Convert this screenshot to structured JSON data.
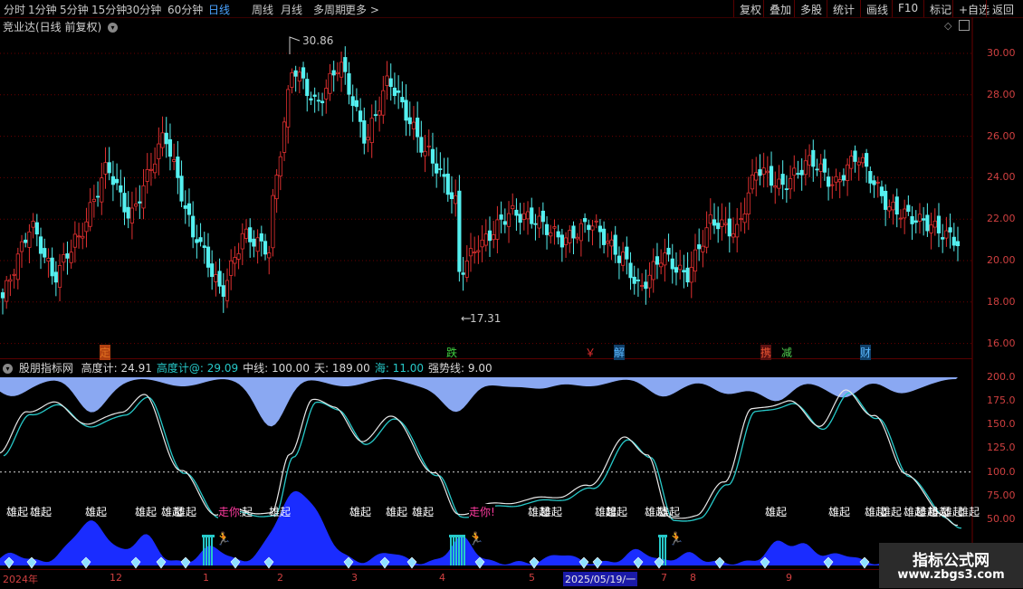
{
  "toolbar": {
    "periods": [
      "分时",
      "1分钟",
      "5分钟",
      "15分钟",
      "30分钟",
      "60分钟",
      "日线",
      "周线",
      "月线",
      "多周期",
      "更多 >"
    ],
    "active_period": "日线",
    "right_buttons": [
      "复权",
      "叠加",
      "多股",
      "统计",
      "画线",
      "F10",
      "标记",
      "+自选",
      "返回"
    ]
  },
  "main_chart": {
    "title": "竞业达(日线 前复权)",
    "price_ticks": [
      "30.00",
      "28.00",
      "26.00",
      "24.00",
      "22.00",
      "20.00",
      "18.00",
      "16.00"
    ],
    "max_label": "30.86",
    "min_label": "17.31",
    "signals": [
      "定",
      "跌",
      "￥",
      "解",
      "携",
      "减",
      "财"
    ]
  },
  "indicator": {
    "name": "股朋指标网",
    "items": [
      {
        "label": "高度计: 24.91",
        "color": "#d8d8d8"
      },
      {
        "label": "高度计@: 29.09",
        "color": "#27c9c9"
      },
      {
        "label": "中线: 100.00",
        "color": "#d8d8d8"
      },
      {
        "label": "天: 189.00",
        "color": "#d8d8d8"
      },
      {
        "label": "海: 11.00",
        "color": "#27c9c9"
      },
      {
        "label": "强势线: 9.00",
        "color": "#d8d8d8"
      }
    ],
    "ticks": [
      "200.0",
      "175.0",
      "150.0",
      "125.0",
      "100.0",
      "75.00",
      "50.00"
    ],
    "rise_text": "雄起",
    "go_text_1": "走你",
    "go_text_2": "走你!"
  },
  "x_axis": {
    "labels": [
      "2024年",
      "12",
      "1",
      "2",
      "3",
      "4",
      "5",
      "2025/05/19/一",
      "7",
      "8",
      "9"
    ]
  },
  "watermark": {
    "line1": "指标公式网",
    "line2": "www.zbgs3.com"
  },
  "colors": {
    "up": "#e03030",
    "down": "#54f0f0",
    "area_top": "#8aa8f2",
    "area_bottom": "#1a2cff",
    "grid": "#6a0000"
  }
}
